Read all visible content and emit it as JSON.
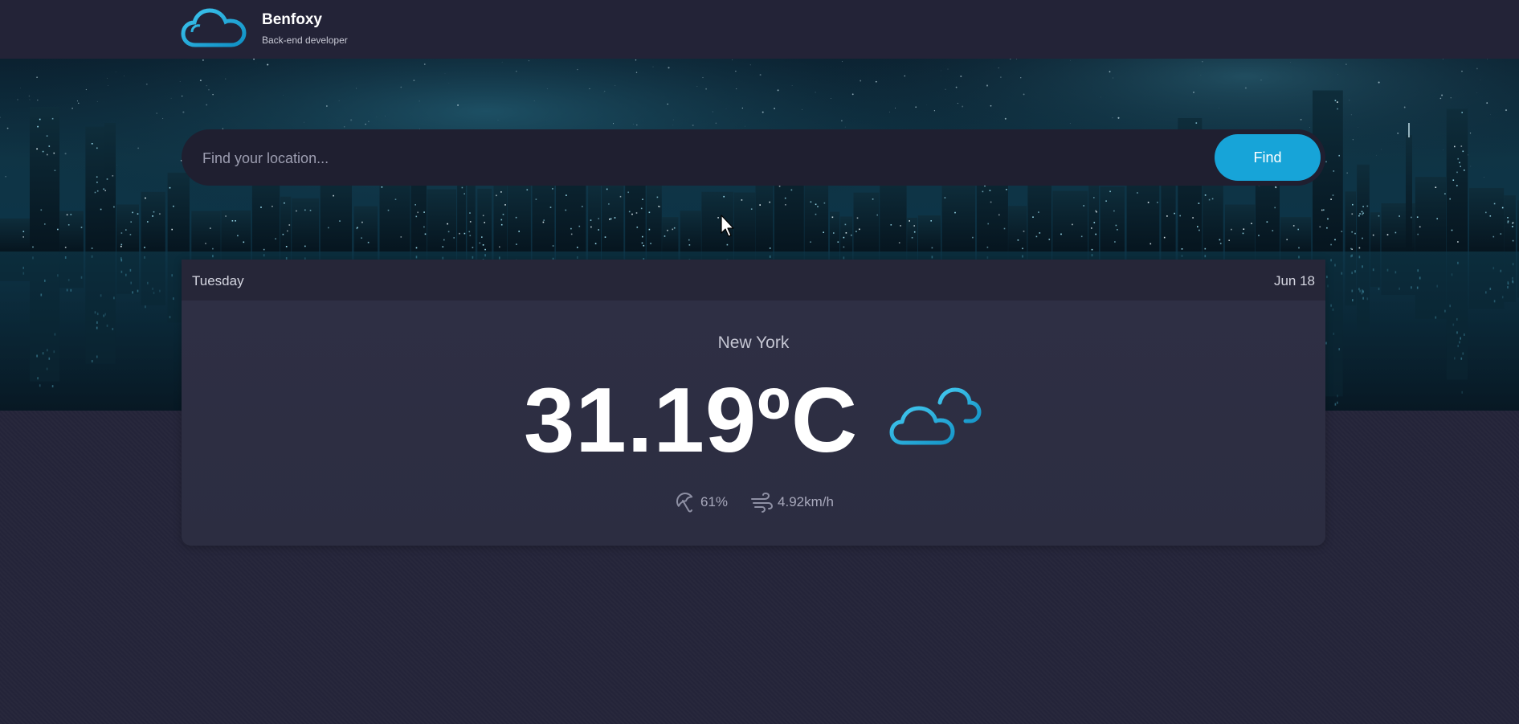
{
  "brand": {
    "name": "Benfoxy",
    "subtitle": "Back-end developer",
    "logo_icon": "cloud-logo-icon"
  },
  "search": {
    "placeholder": "Find your location...",
    "value": "",
    "button_label": "Find"
  },
  "weather": {
    "day": "Tuesday",
    "date": "Jun 18",
    "city": "New York",
    "temperature": "31.19ºC",
    "condition_icon": "cloudy-icon",
    "humidity": "61%",
    "humidity_icon": "umbrella-icon",
    "wind": "4.92km/h",
    "wind_icon": "wind-icon"
  },
  "colors": {
    "accent": "#17a4d8",
    "background": "#25253a",
    "card": "#2d2e42",
    "header_bar": "#232337"
  }
}
